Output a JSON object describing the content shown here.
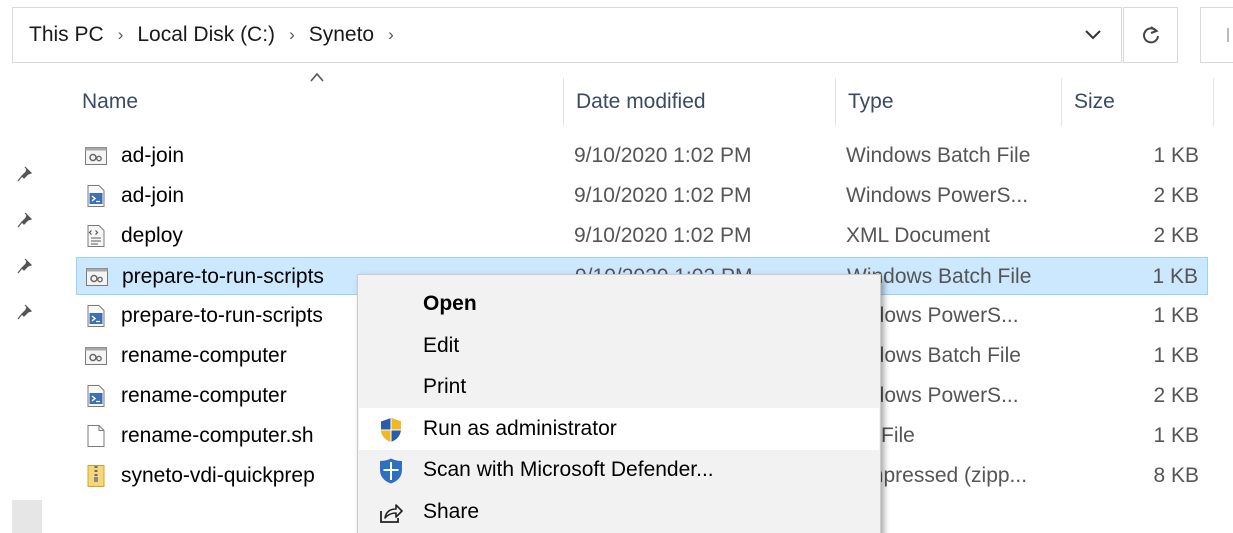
{
  "address_bar": {
    "crumbs": [
      "This PC",
      "Local Disk (C:)",
      "Syneto"
    ],
    "separator": "›"
  },
  "columns": {
    "name": "Name",
    "date_modified": "Date modified",
    "type": "Type",
    "size": "Size"
  },
  "files": [
    {
      "name": "ad-join",
      "date": "9/10/2020 1:02 PM",
      "type": "Windows Batch File",
      "size": "1 KB",
      "icon": "batch-file-icon"
    },
    {
      "name": "ad-join",
      "date": "9/10/2020 1:02 PM",
      "type": "Windows PowerS...",
      "size": "2 KB",
      "icon": "powershell-file-icon"
    },
    {
      "name": "deploy",
      "date": "9/10/2020 1:02 PM",
      "type": "XML Document",
      "size": "2 KB",
      "icon": "xml-file-icon"
    },
    {
      "name": "prepare-to-run-scripts",
      "date": "9/10/2020 1:02 PM",
      "type": "Windows Batch File",
      "size": "1 KB",
      "icon": "batch-file-icon",
      "selected": true
    },
    {
      "name": "prepare-to-run-scripts",
      "date": "",
      "type": "ndows PowerS...",
      "size": "1 KB",
      "icon": "powershell-file-icon"
    },
    {
      "name": "rename-computer",
      "date": "",
      "type": "ndows Batch File",
      "size": "1 KB",
      "icon": "batch-file-icon"
    },
    {
      "name": "rename-computer",
      "date": "",
      "type": "ndows PowerS...",
      "size": "2 KB",
      "icon": "powershell-file-icon"
    },
    {
      "name": "rename-computer.sh",
      "date": "",
      "type": "File",
      "size": "1 KB",
      "icon": "blank-file-icon"
    },
    {
      "name": "syneto-vdi-quickprep",
      "date": "",
      "type": "mpressed (zipp...",
      "size": "8 KB",
      "icon": "zip-folder-icon"
    }
  ],
  "selected_row_partial": {
    "date_fragment": "9/10/2020 1:02 PM",
    "type_fragment": "ndows Batch File"
  },
  "context_menu": {
    "items": [
      {
        "label": "Open",
        "bold": true,
        "icon": null
      },
      {
        "label": "Edit",
        "bold": false,
        "icon": null
      },
      {
        "label": "Print",
        "bold": false,
        "icon": null
      },
      {
        "label": "Run as administrator",
        "bold": false,
        "icon": "uac-shield-icon",
        "hover": true
      },
      {
        "label": "Scan with Microsoft Defender...",
        "bold": false,
        "icon": "defender-icon"
      },
      {
        "label": "Share",
        "bold": false,
        "icon": "share-icon"
      }
    ]
  },
  "colors": {
    "selection_bg": "#cce8ff",
    "selection_border": "#99d1ff",
    "menu_bg": "#f2f2f2",
    "header_text": "#3b4a63"
  }
}
